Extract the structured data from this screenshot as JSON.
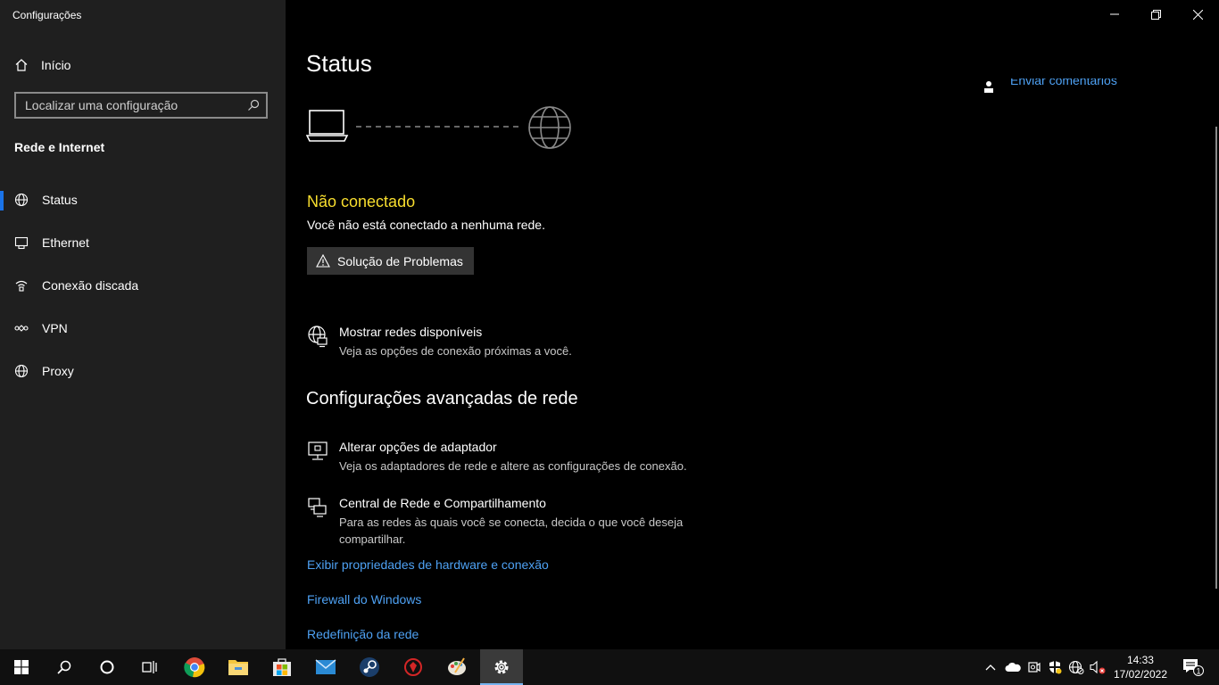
{
  "window": {
    "title": "Configurações"
  },
  "sidebar": {
    "home_label": "Início",
    "search_placeholder": "Localizar uma configuração",
    "section_title": "Rede e Internet",
    "items": [
      {
        "label": "Status",
        "icon": "globe-icon",
        "active": true
      },
      {
        "label": "Ethernet",
        "icon": "ethernet-icon"
      },
      {
        "label": "Conexão discada",
        "icon": "dialup-icon"
      },
      {
        "label": "VPN",
        "icon": "vpn-icon"
      },
      {
        "label": "Proxy",
        "icon": "globe-icon"
      }
    ]
  },
  "main": {
    "title": "Status",
    "feedback_label": "Enviar comentários",
    "status_heading": "Não conectado",
    "status_desc": "Você não está conectado a nenhuma rede.",
    "troubleshoot_label": "Solução de Problemas",
    "show_networks": {
      "title": "Mostrar redes disponíveis",
      "desc": "Veja as opções de conexão próximas a você."
    },
    "advanced_title": "Configurações avançadas de rede",
    "adapter": {
      "title": "Alterar opções de adaptador",
      "desc": "Veja os adaptadores de rede e altere as configurações de conexão."
    },
    "sharing": {
      "title": "Central de Rede e Compartilhamento",
      "desc": "Para as redes às quais você se conecta, decida o que você deseja compartilhar."
    },
    "links": [
      "Exibir propriedades de hardware e conexão",
      "Firewall do Windows",
      "Redefinição da rede"
    ]
  },
  "taskbar": {
    "time": "14:33",
    "date": "17/02/2022",
    "notification_count": "1"
  },
  "colors": {
    "accent": "#1a73e8",
    "link": "#4ea1f3",
    "warning": "#f8de2e",
    "sidebar_bg": "#1f1f1f"
  }
}
